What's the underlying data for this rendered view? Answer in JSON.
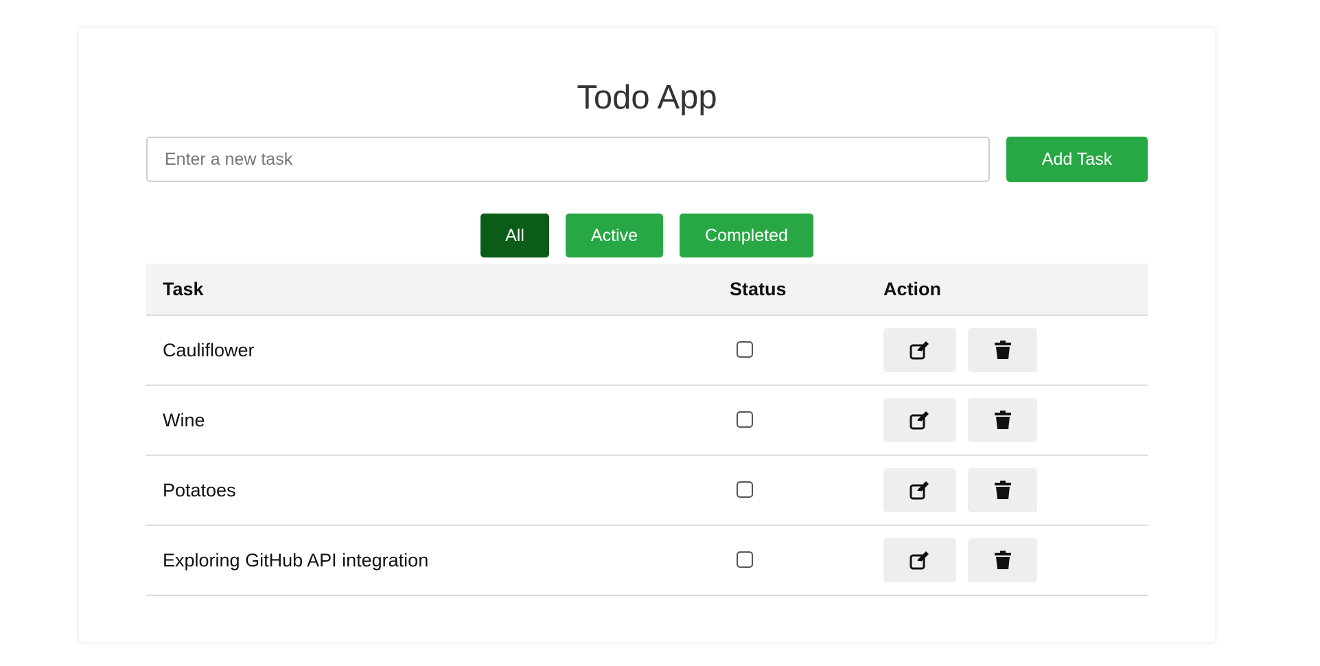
{
  "app": {
    "title": "Todo App"
  },
  "new_task": {
    "placeholder": "Enter a new task",
    "value": "",
    "add_label": "Add Task"
  },
  "filters": [
    {
      "label": "All",
      "selected": true
    },
    {
      "label": "Active",
      "selected": false
    },
    {
      "label": "Completed",
      "selected": false
    }
  ],
  "table": {
    "headers": {
      "task": "Task",
      "status": "Status",
      "action": "Action"
    },
    "rows": [
      {
        "task": "Cauliflower",
        "completed": false
      },
      {
        "task": "Wine",
        "completed": false
      },
      {
        "task": "Potatoes",
        "completed": false
      },
      {
        "task": "Exploring GitHub API integration",
        "completed": false
      }
    ]
  },
  "icons": {
    "edit": "edit-icon",
    "delete": "trash-icon"
  },
  "colors": {
    "primary_green": "#28a745",
    "selected_filter_green": "#0a5c17",
    "header_bg": "#f3f3f3",
    "action_button_bg": "#eeeeee"
  }
}
